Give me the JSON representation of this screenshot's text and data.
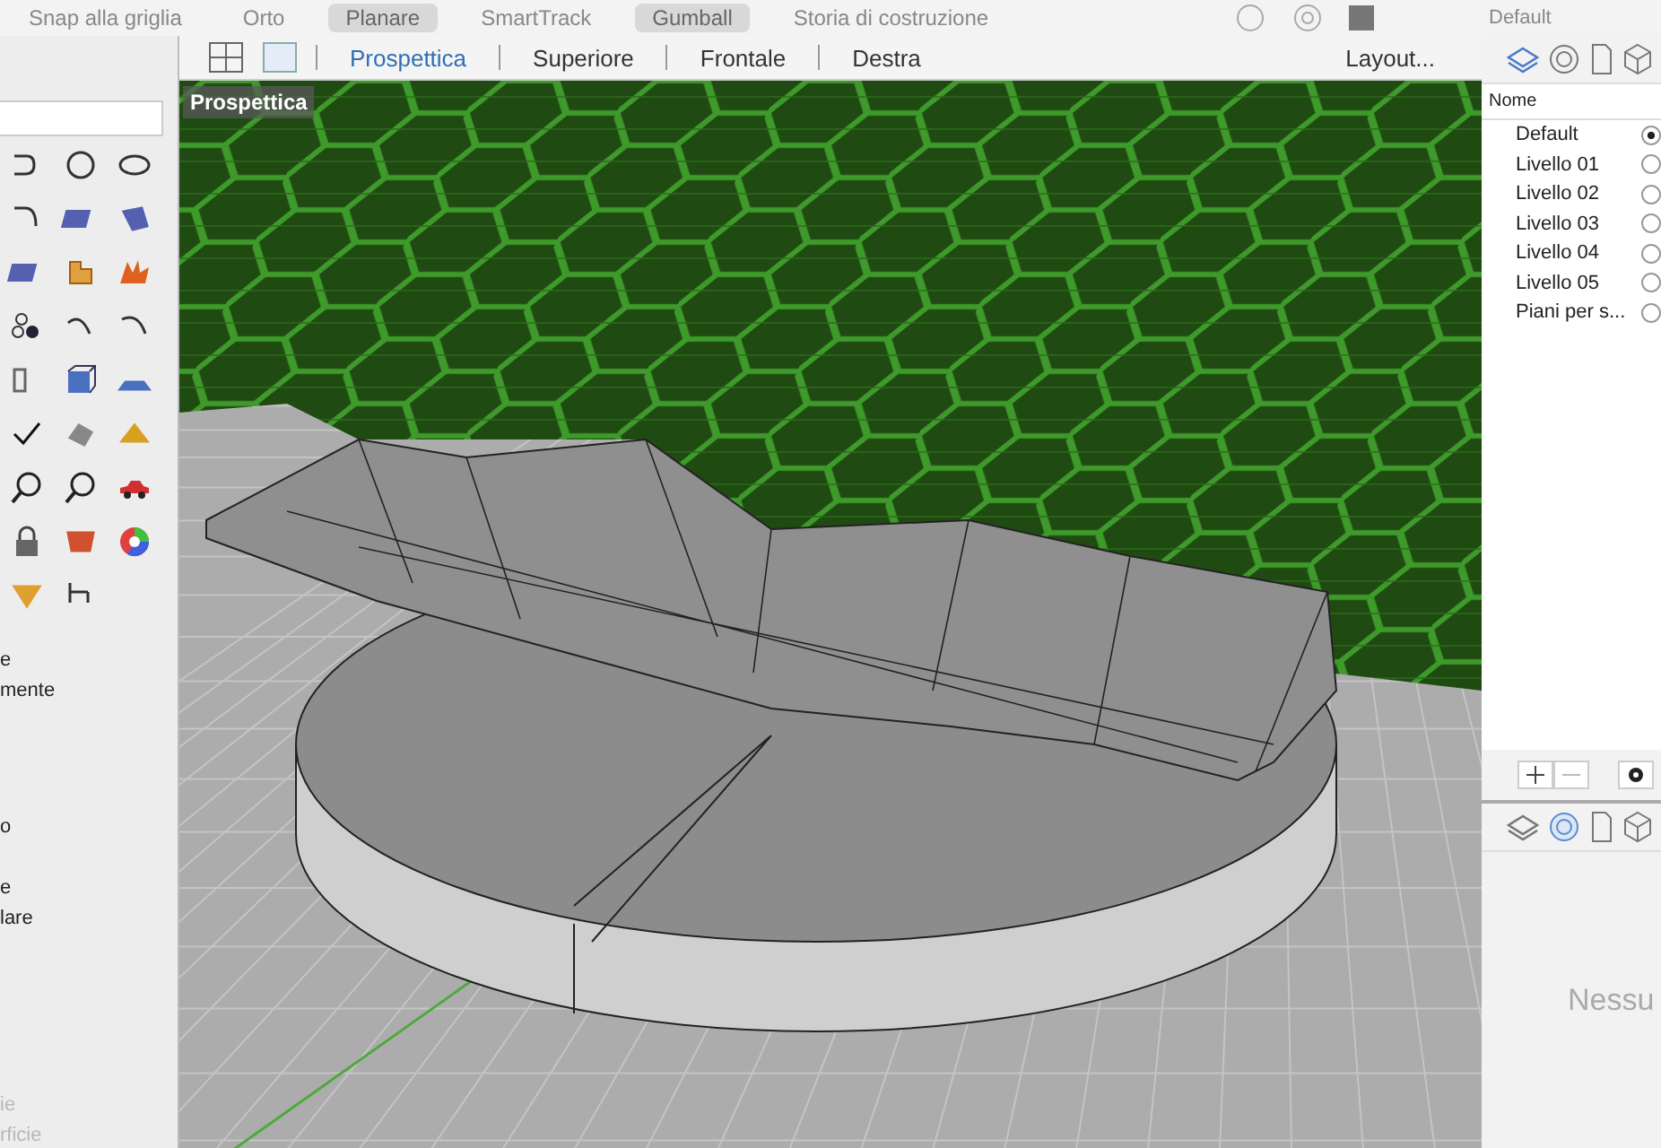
{
  "toolbar": {
    "items": [
      {
        "label": "Snap alla griglia",
        "on": false
      },
      {
        "label": "Orto",
        "on": false
      },
      {
        "label": "Planare",
        "on": true
      },
      {
        "label": "SmartTrack",
        "on": false
      },
      {
        "label": "Gumball",
        "on": true
      },
      {
        "label": "Storia di costruzione",
        "on": false
      }
    ],
    "layer_field": "Default"
  },
  "commands": [
    {
      "label": "e",
      "disabled": false
    },
    {
      "label": "mente",
      "disabled": false
    },
    {
      "label": "o",
      "disabled": false
    },
    {
      "label": "e",
      "disabled": false
    },
    {
      "label": "lare",
      "disabled": false
    },
    {
      "label": "ie",
      "disabled": true
    },
    {
      "label": "rficie",
      "disabled": true
    }
  ],
  "viewport": {
    "tabs": [
      {
        "label": "Prospettica",
        "selected": true
      },
      {
        "label": "Superiore",
        "selected": false
      },
      {
        "label": "Frontale",
        "selected": false
      },
      {
        "label": "Destra",
        "selected": false
      }
    ],
    "layout_button": "Layout...",
    "label": "Prospettica"
  },
  "layers": {
    "column": "Nome",
    "items": [
      {
        "name": "Default",
        "selected": true
      },
      {
        "name": "Livello 01",
        "selected": false
      },
      {
        "name": "Livello 02",
        "selected": false
      },
      {
        "name": "Livello 03",
        "selected": false
      },
      {
        "name": "Livello 04",
        "selected": false
      },
      {
        "name": "Livello 05",
        "selected": false
      },
      {
        "name": "Piani per s...",
        "selected": false
      }
    ]
  },
  "bottom_panel": {
    "message": "Nessu"
  }
}
